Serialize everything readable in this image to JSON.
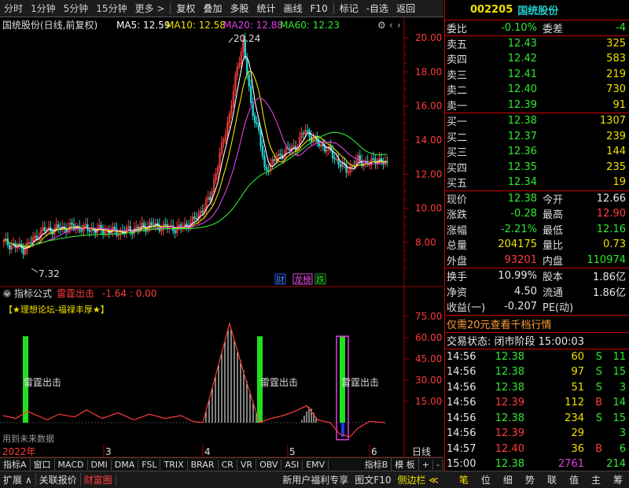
{
  "toolbar": {
    "items": [
      "分时",
      "1分钟",
      "5分钟",
      "15分钟",
      "更多 >",
      "复权",
      "叠加",
      "多股",
      "统计",
      "画线",
      "F10",
      "标记",
      "-自选",
      "返回"
    ]
  },
  "main_chart": {
    "title": "国统股份(日线,前复权)",
    "ma5": "MA5: 12.59",
    "ma10": "MA10: 12.58",
    "ma20": "MA20: 12.88",
    "ma60": "MA60: 12.23",
    "high_label": "20.24",
    "low_label": "7.32",
    "price_ticks": [
      "20.00",
      "18.00",
      "16.00",
      "14.00",
      "12.00",
      "10.00",
      "8.00"
    ],
    "badges": [
      "财",
      "榜",
      "跌"
    ]
  },
  "indicator": {
    "title": "指标公式",
    "name": "雷霆出击",
    "values": "-1.64 : 0.00",
    "banner": "【★理想论坛-福禄丰厚★】",
    "signal_label": "雷霆出击",
    "note": "用到未来数据",
    "ticks": [
      "75.00",
      "60.00",
      "45.00",
      "30.00",
      "15.00"
    ]
  },
  "time_axis": {
    "year": "2022年",
    "months": [
      "3",
      "4",
      "5",
      "6"
    ],
    "mode": "日线"
  },
  "tabs": [
    "指标A",
    "窗口",
    "MACD",
    "DMI",
    "DMA",
    "FSL",
    "TRIX",
    "BRAR",
    "CR",
    "VR",
    "OBV",
    "ASI",
    "EMV",
    "指标B",
    "模 板",
    "+",
    "-"
  ],
  "bottom": {
    "left": [
      "扩展 ∧",
      "关联报价",
      "财富圈"
    ],
    "mid": [
      "新用户福利专享",
      "图文F10",
      "侧边栏 ≪"
    ],
    "right": [
      "笔",
      "位",
      "细",
      "势",
      "联",
      "值",
      "主",
      "筹"
    ]
  },
  "quote": {
    "code": "002205",
    "name": "国统股份",
    "weibi": {
      "label": "委比",
      "value": "-0.10%",
      "label2": "委差",
      "value2": "-4"
    },
    "asks": [
      {
        "label": "卖五",
        "price": "12.43",
        "vol": "325"
      },
      {
        "label": "卖四",
        "price": "12.42",
        "vol": "583"
      },
      {
        "label": "卖三",
        "price": "12.41",
        "vol": "219"
      },
      {
        "label": "卖二",
        "price": "12.40",
        "vol": "730"
      },
      {
        "label": "卖一",
        "price": "12.39",
        "vol": "91"
      }
    ],
    "bids": [
      {
        "label": "买一",
        "price": "12.38",
        "vol": "1307"
      },
      {
        "label": "买二",
        "price": "12.37",
        "vol": "239"
      },
      {
        "label": "买三",
        "price": "12.36",
        "vol": "144"
      },
      {
        "label": "买四",
        "price": "12.35",
        "vol": "235"
      },
      {
        "label": "买五",
        "price": "12.34",
        "vol": "19"
      }
    ],
    "stats": [
      {
        "l1": "现价",
        "v1": "12.38",
        "c1": "green",
        "l2": "今开",
        "v2": "12.66",
        "c2": "white"
      },
      {
        "l1": "涨跌",
        "v1": "-0.28",
        "c1": "green",
        "l2": "最高",
        "v2": "12.90",
        "c2": "red"
      },
      {
        "l1": "涨幅",
        "v1": "-2.21%",
        "c1": "green",
        "l2": "最低",
        "v2": "12.16",
        "c2": "green"
      },
      {
        "l1": "总量",
        "v1": "204175",
        "c1": "yellow",
        "l2": "量比",
        "v2": "0.73",
        "c2": "yellow"
      },
      {
        "l1": "外盘",
        "v1": "93201",
        "c1": "red",
        "l2": "内盘",
        "v2": "110974",
        "c2": "green"
      }
    ],
    "stats2": [
      {
        "l1": "换手",
        "v1": "10.99%",
        "l2": "股本",
        "v2": "1.86亿"
      },
      {
        "l1": "净资",
        "v1": "4.50",
        "l2": "流通",
        "v2": "1.86亿"
      },
      {
        "l1": "收益(一)",
        "v1": "-0.207",
        "l2": "PE(动)",
        "v2": ""
      }
    ],
    "promo": "仅需20元查看千档行情",
    "status": "交易状态: 闭市阶段  15:00:03",
    "ticks": [
      {
        "time": "14:56",
        "price": "12.38",
        "vol": "60",
        "flag": "S",
        "n": "11"
      },
      {
        "time": "14:56",
        "price": "12.38",
        "vol": "97",
        "flag": "S",
        "n": "15"
      },
      {
        "time": "14:56",
        "price": "12.38",
        "vol": "51",
        "flag": "S",
        "n": "3"
      },
      {
        "time": "14:56",
        "price": "12.39",
        "vol": "112",
        "flag": "B",
        "n": "14"
      },
      {
        "time": "14:56",
        "price": "12.38",
        "vol": "234",
        "flag": "S",
        "n": "15"
      },
      {
        "time": "14:56",
        "price": "12.39",
        "vol": "29",
        "flag": "",
        "n": "3"
      },
      {
        "time": "14:57",
        "price": "12.40",
        "vol": "36",
        "flag": "B",
        "n": "6"
      },
      {
        "time": "15:00",
        "price": "12.38",
        "vol": "2761",
        "flag": "",
        "n": "214"
      }
    ]
  },
  "colors": {
    "up": "#ff3c3c",
    "down": "#30e830",
    "ma5": "#ffffff",
    "ma10": "#f0e000",
    "ma20": "#e040e0",
    "ma60": "#30e830",
    "accent": "#c00000"
  }
}
